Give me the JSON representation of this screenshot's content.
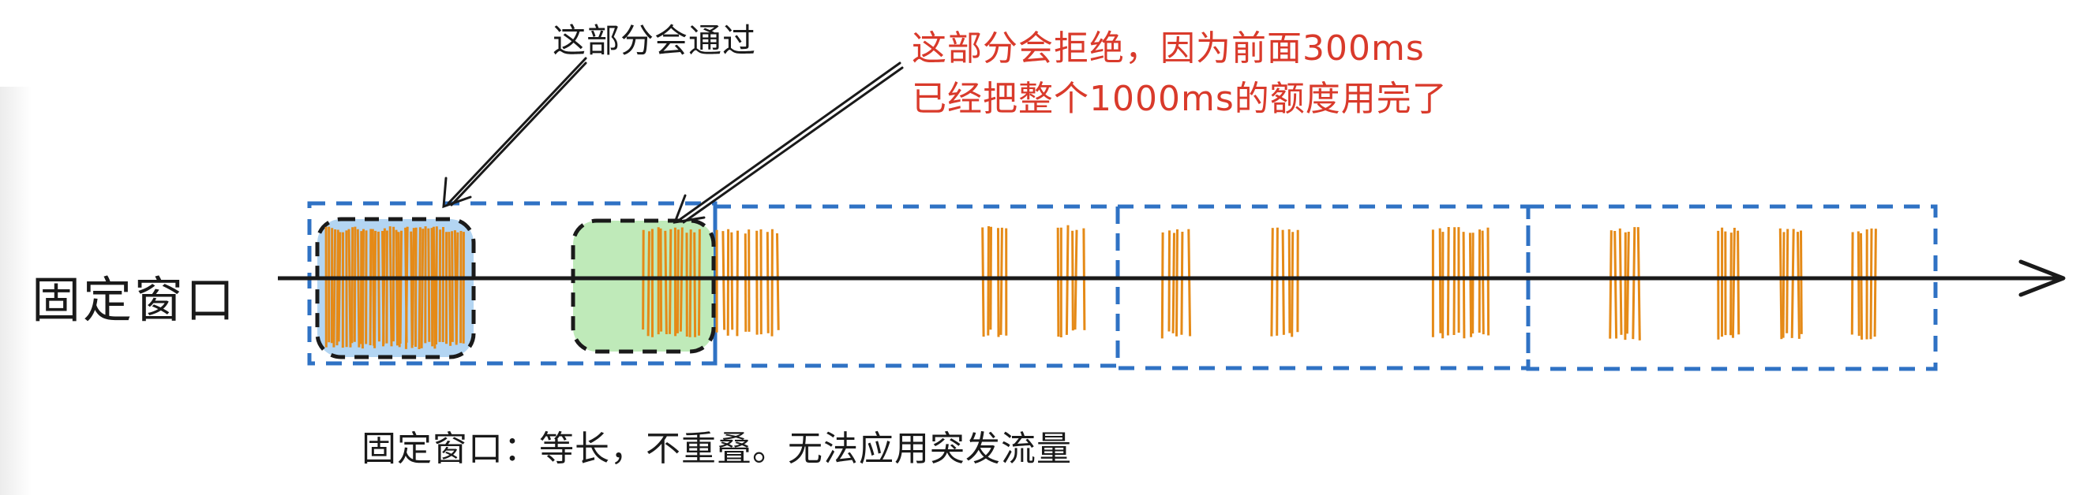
{
  "axis_label": "固定窗口",
  "annotations": {
    "pass_note": "这部分会通过",
    "reject_note_line1": "这部分会拒绝，因为前面300ms",
    "reject_note_line2": "已经把整个1000ms的额度用完了"
  },
  "caption": "固定窗口：等长，不重叠。无法应用突发流量",
  "colors": {
    "window_border": "#2f72c4",
    "pass_fill": "#b3d5f2",
    "reject_fill": "#bfeab9",
    "request_ticks": "#e58a17",
    "reject_text": "#d93a2b",
    "axis": "#1a1a1a"
  },
  "fixed_windows_count": 4
}
